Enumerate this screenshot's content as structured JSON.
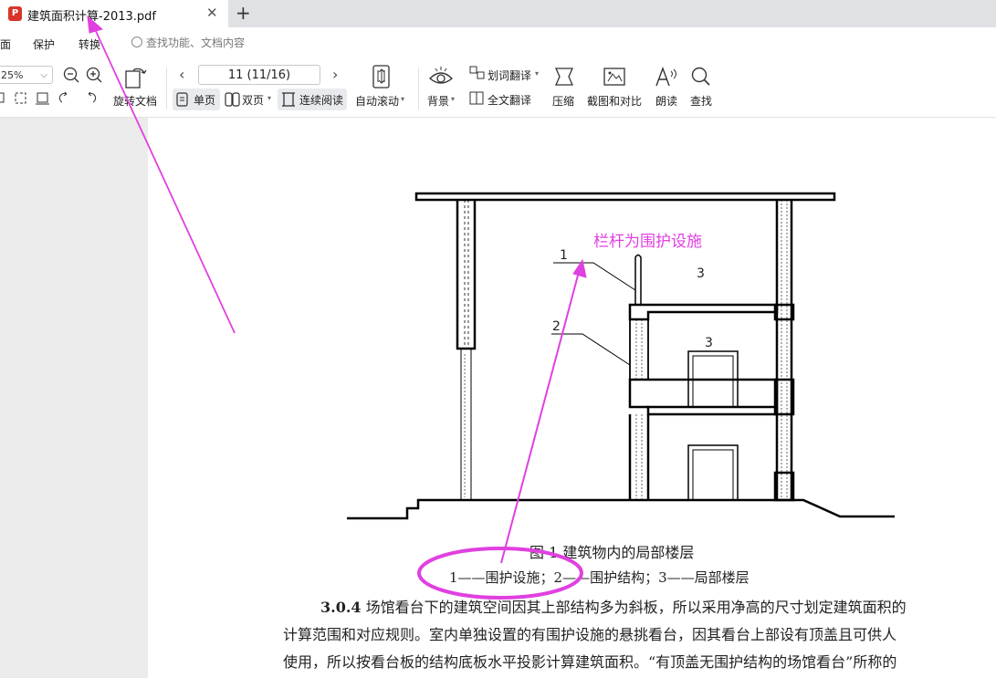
{
  "tab": {
    "title": "建筑面积计算-2013.pdf",
    "pdf_glyph": "P",
    "close_glyph": "✕",
    "new_glyph": "+"
  },
  "menu": {
    "items": [
      "面",
      "保护",
      "转换"
    ],
    "search_placeholder": "查找功能、文档内容"
  },
  "toolbar": {
    "zoom_value": "25%",
    "rotate_label": "旋转文档",
    "page_indicator": "11 (11/16)",
    "single_page": "单页",
    "double_page": "双页",
    "continuous_read": "连续阅读",
    "auto_scroll": "自动滚动",
    "background": "背景",
    "word_translate": "划词翻译",
    "full_translate": "全文翻译",
    "compress": "压缩",
    "screenshot_compare": "截图和对比",
    "read_aloud": "朗读",
    "find": "查找"
  },
  "document": {
    "figure_title": "图 1  建筑物内的局部楼层",
    "figure_legend": "1——围护设施；2——围护结构；3——局部楼层",
    "paragraph_lead": "3.0.4",
    "paragraph_lines": [
      "场馆看台下的建筑空间因其上部结构多为斜板，所以采用净高的尺寸划定建筑面积的",
      "计算范围和对应规则。室内单独设置的有围护设施的悬挑看台，因其看台上部设有顶盖且可供人",
      "使用，所以按看台板的结构底板水平投影计算建筑面积。“有顶盖无围护结构的场馆看台”所称的"
    ],
    "label_1": "1",
    "label_2": "2",
    "label_3_top": "3",
    "label_3_mid": "3"
  },
  "annotation": {
    "text": "栏杆为围护设施",
    "color": "#e040e0"
  },
  "colors": {
    "annotation": "#e040e0",
    "accent_red": "#d9342b"
  }
}
